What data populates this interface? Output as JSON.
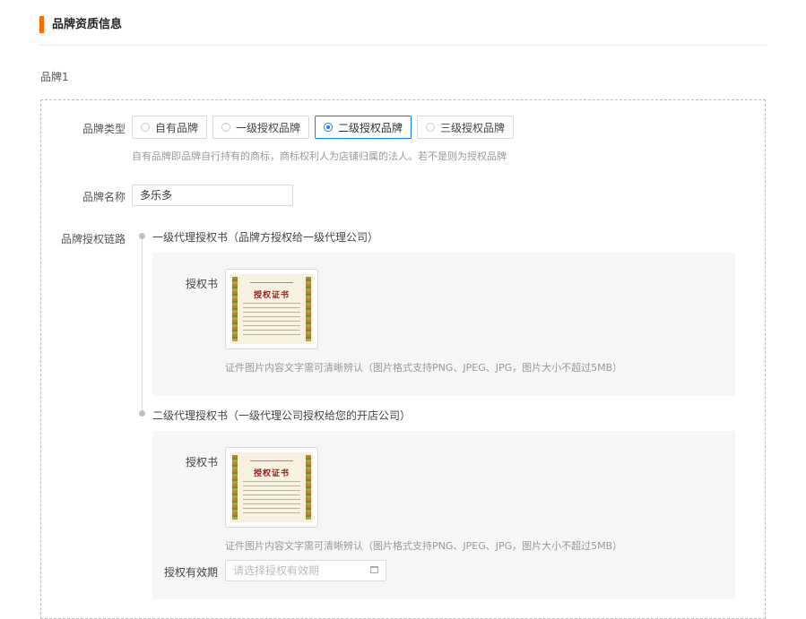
{
  "section": {
    "title": "品牌资质信息",
    "accent": "#ff6a00"
  },
  "brand_block_label": "品牌1",
  "brand_type": {
    "label": "品牌类型",
    "options": [
      "自有品牌",
      "一级授权品牌",
      "二级授权品牌",
      "三级授权品牌"
    ],
    "selected": "二级授权品牌",
    "hint": "自有品牌即品牌自行持有的商标，商标权利人为店铺归属的法人。若不是则为授权品牌"
  },
  "brand_name": {
    "label": "品牌名称",
    "value": "多乐多"
  },
  "auth_chain": {
    "label": "品牌授权链路",
    "steps": [
      {
        "title": "一级代理授权书（品牌方授权给一级代理公司）",
        "field_label": "授权书",
        "cert_title": "授权证书",
        "hint": "证件图片内容文字需可清晰辨认（图片格式支持PNG、JPEG、JPG，图片大小不超过5MB）"
      },
      {
        "title": "二级代理授权书（一级代理公司授权给您的开店公司）",
        "field_label": "授权书",
        "cert_title": "授权证书",
        "hint": "证件图片内容文字需可清晰辨认（图片格式支持PNG、JPEG、JPG，图片大小不超过5MB）",
        "validity_label": "授权有效期",
        "validity_placeholder": "请选择授权有效期"
      }
    ]
  },
  "colors": {
    "primary": "#1677ff",
    "panel_bg": "#f5f6f8"
  }
}
